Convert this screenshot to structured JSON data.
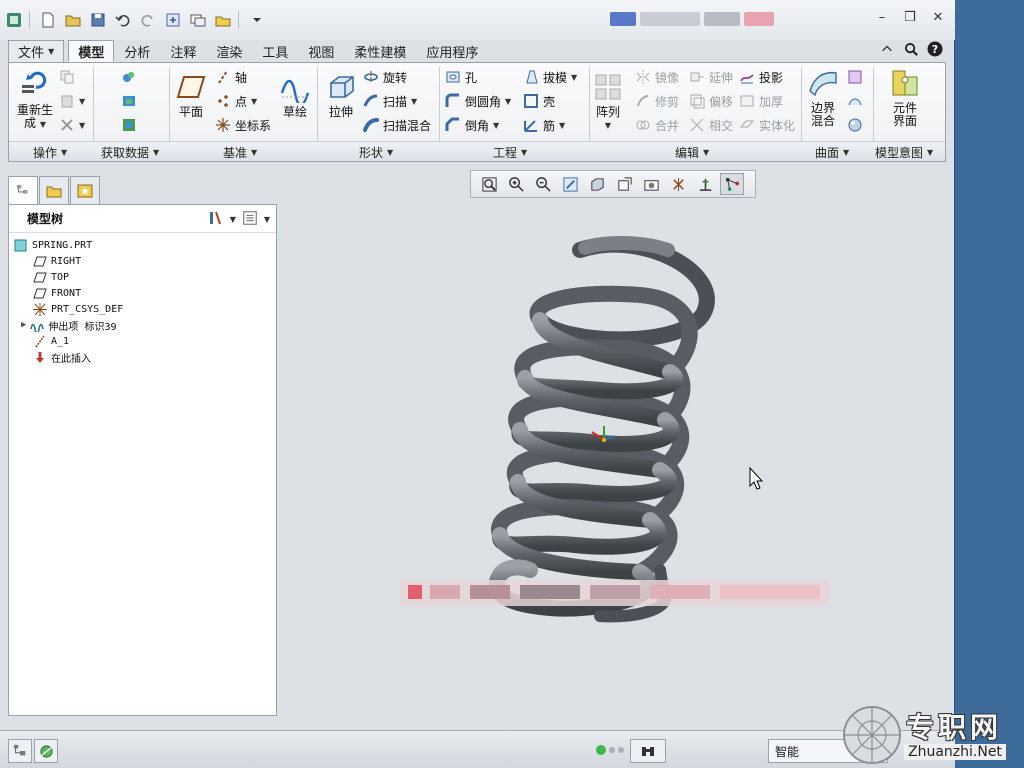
{
  "quick_access": {
    "icons": [
      "app-icon",
      "new-icon",
      "open-icon",
      "save-icon",
      "undo-icon",
      "redo-icon",
      "regenerate-icon",
      "windows-icon",
      "open-folder-icon",
      "customize-icon"
    ]
  },
  "tabs": [
    {
      "label": "文件"
    },
    {
      "label": "模型"
    },
    {
      "label": "分析"
    },
    {
      "label": "注释"
    },
    {
      "label": "渲染"
    },
    {
      "label": "工具"
    },
    {
      "label": "视图"
    },
    {
      "label": "柔性建模"
    },
    {
      "label": "应用程序"
    }
  ],
  "ribbon": {
    "operations": {
      "regenerate_line1": "重新生",
      "regenerate_line2": "成",
      "group_label": "操作"
    },
    "get_data": {
      "group_label": "获取数据"
    },
    "datum": {
      "plane": "平面",
      "axis": "轴",
      "point": "点",
      "csys": "坐标系",
      "sketch": "草绘",
      "group_label": "基准"
    },
    "shapes": {
      "extrude": "拉伸",
      "revolve": "旋转",
      "sweep": "扫描",
      "swept_blend": "扫描混合",
      "group_label": "形状"
    },
    "engineering": {
      "hole": "孔",
      "round": "倒圆角",
      "chamfer": "倒角",
      "draft": "拔模",
      "shell": "壳",
      "rib": "筋",
      "group_label": "工程"
    },
    "editing": {
      "pattern": "阵列",
      "mirror": "镜像",
      "trim": "修剪",
      "merge": "合并",
      "extend": "延伸",
      "offset": "偏移",
      "intersect": "相交",
      "project": "投影",
      "thicken": "加厚",
      "solidify": "实体化",
      "group_label": "编辑"
    },
    "surfaces": {
      "boundary_line1": "边界",
      "boundary_line2": "混合",
      "group_label": "曲面"
    },
    "model_intent": {
      "component_line1": "元件",
      "component_line2": "界面",
      "group_label": "模型意图"
    }
  },
  "model_tree": {
    "header": "模型树",
    "items": [
      {
        "label": "SPRING.PRT"
      },
      {
        "label": "RIGHT"
      },
      {
        "label": "TOP"
      },
      {
        "label": "FRONT"
      },
      {
        "label": "PRT_CSYS_DEF"
      },
      {
        "label": "伸出项 标识39"
      },
      {
        "label": "A_1"
      },
      {
        "label": "在此插入"
      }
    ]
  },
  "status_bar": {
    "filter_value": "智能"
  },
  "watermark": {
    "text_cn": "专职网",
    "text_en": "Zhuanzhi.Net"
  },
  "colors": {
    "accent": "#2f5d8c",
    "spring": "#6d7378",
    "desktop": "#3d6c9b"
  }
}
